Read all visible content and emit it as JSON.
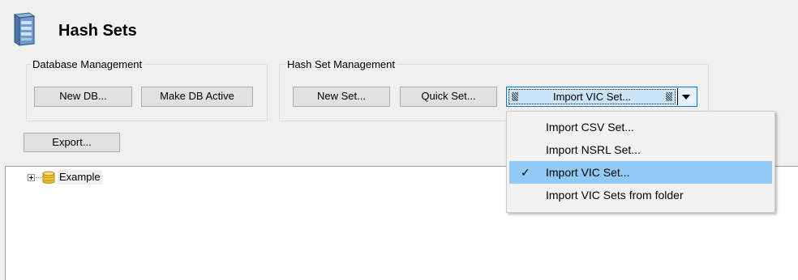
{
  "header": {
    "title": "Hash Sets",
    "icon": "server-database-icon"
  },
  "database_management": {
    "label": "Database Management",
    "new_db": "New DB...",
    "make_active": "Make DB Active"
  },
  "hash_set_management": {
    "label": "Hash Set Management",
    "new_set": "New Set...",
    "quick_set": "Quick Set...",
    "import_selected": "Import VIC Set..."
  },
  "export_label": "Export...",
  "tree": {
    "items": [
      {
        "label": "Example",
        "icon": "database-icon",
        "expander": "expand-plus-icon"
      }
    ]
  },
  "import_menu": {
    "items": [
      {
        "label": "Import CSV Set...",
        "checked": false
      },
      {
        "label": "Import NSRL Set...",
        "checked": false
      },
      {
        "label": "Import VIC Set...",
        "checked": true
      },
      {
        "label": "Import VIC Sets from folder",
        "checked": false
      }
    ]
  },
  "colors": {
    "window_bg": "#f0f0f0",
    "menu_highlight": "#91c9f7",
    "button_face": "#e1e1e1"
  }
}
